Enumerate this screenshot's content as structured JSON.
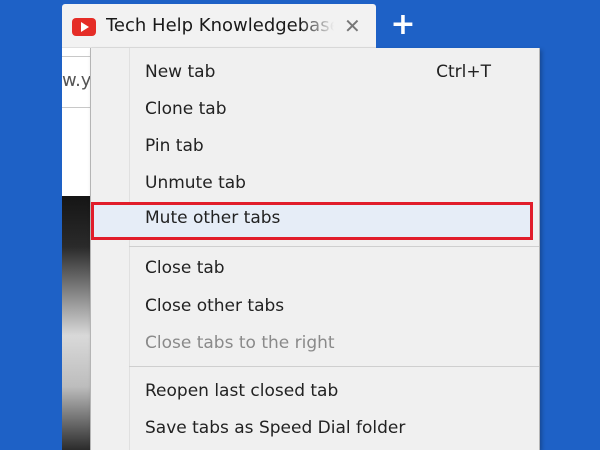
{
  "tab": {
    "title": "Tech Help Knowledgebase",
    "close_glyph": "✕",
    "favicon": "youtube-icon"
  },
  "new_tab_button": {
    "glyph": "+"
  },
  "address_bar": {
    "text": "w.y"
  },
  "context_menu": {
    "items": [
      {
        "label": "New tab",
        "shortcut": "Ctrl+T"
      },
      {
        "label": "Clone tab"
      },
      {
        "label": "Pin tab"
      },
      {
        "label": "Unmute tab"
      },
      {
        "label": "Mute other tabs",
        "highlighted": true
      },
      {
        "label": "Close tab"
      },
      {
        "label": "Close other tabs"
      },
      {
        "label": "Close tabs to the right",
        "disabled": true
      },
      {
        "label": "Reopen last closed tab"
      },
      {
        "label": "Save tabs as Speed Dial folder"
      }
    ]
  },
  "colors": {
    "background": "#1e61c6",
    "highlight_border": "#e11d2b",
    "menu_bg": "#f0f0f0"
  }
}
